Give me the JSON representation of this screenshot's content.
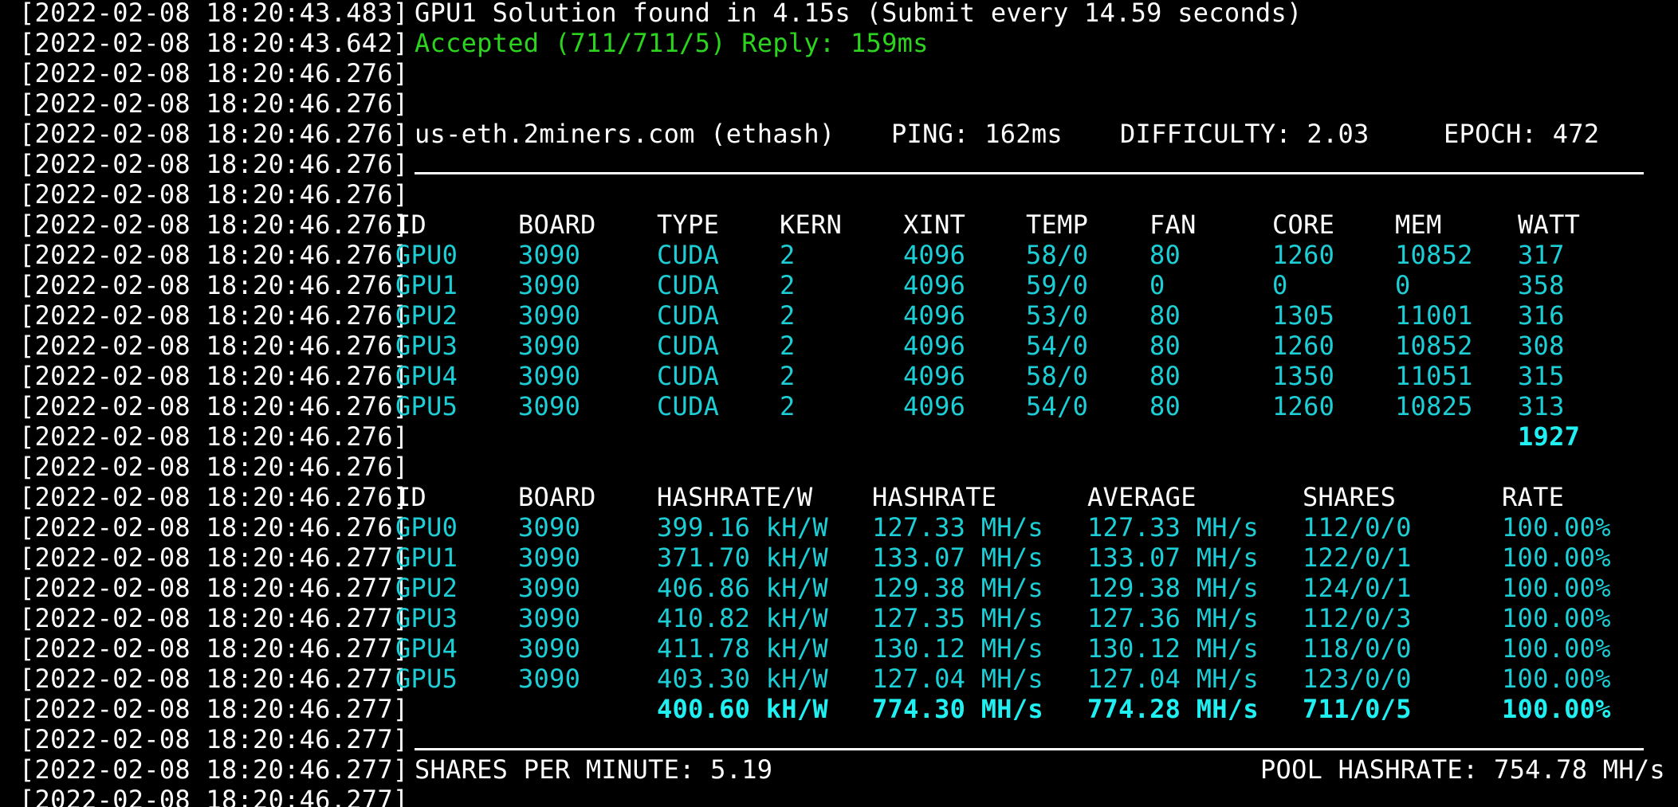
{
  "top": {
    "ts1": "[2022-02-08 18:20:43.483]",
    "msg1": "GPU1 Solution found in 4.15s (Submit every 14.59 seconds)",
    "ts2": "[2022-02-08 18:20:43.642]",
    "msg2": "Accepted (711/711/5) Reply: 159ms"
  },
  "pool": {
    "ts": "[2022-02-08 18:20:46.276]",
    "host": "us-eth.2miners.com (ethash)",
    "ping": "PING: 162ms",
    "difficulty": "DIFFICULTY: 2.03",
    "epoch": "EPOCH: 472"
  },
  "ts_a": "[2022-02-08 18:20:46.276]",
  "ts_b": "[2022-02-08 18:20:46.277]",
  "device_table": {
    "headers": [
      "ID",
      "BOARD",
      "TYPE",
      "KERN",
      "XINT",
      "TEMP",
      "FAN",
      "CORE",
      "MEM",
      "WATT"
    ],
    "rows": [
      [
        "GPU0",
        "3090",
        "CUDA",
        "2",
        "4096",
        "58/0",
        "80",
        "1260",
        "10852",
        "317"
      ],
      [
        "GPU1",
        "3090",
        "CUDA",
        "2",
        "4096",
        "59/0",
        "0",
        "0",
        "0",
        "358"
      ],
      [
        "GPU2",
        "3090",
        "CUDA",
        "2",
        "4096",
        "53/0",
        "80",
        "1305",
        "11001",
        "316"
      ],
      [
        "GPU3",
        "3090",
        "CUDA",
        "2",
        "4096",
        "54/0",
        "80",
        "1260",
        "10852",
        "308"
      ],
      [
        "GPU4",
        "3090",
        "CUDA",
        "2",
        "4096",
        "58/0",
        "80",
        "1350",
        "11051",
        "315"
      ],
      [
        "GPU5",
        "3090",
        "CUDA",
        "2",
        "4096",
        "54/0",
        "80",
        "1260",
        "10825",
        "313"
      ]
    ],
    "total_watt": "1927"
  },
  "hash_table": {
    "headers": [
      "ID",
      "BOARD",
      "HASHRATE/W",
      "HASHRATE",
      "AVERAGE",
      "SHARES",
      "RATE"
    ],
    "rows": [
      [
        "GPU0",
        "3090",
        "399.16 kH/W",
        "127.33 MH/s",
        "127.33 MH/s",
        "112/0/0",
        "100.00%"
      ],
      [
        "GPU1",
        "3090",
        "371.70 kH/W",
        "133.07 MH/s",
        "133.07 MH/s",
        "122/0/1",
        "100.00%"
      ],
      [
        "GPU2",
        "3090",
        "406.86 kH/W",
        "129.38 MH/s",
        "129.38 MH/s",
        "124/0/1",
        "100.00%"
      ],
      [
        "GPU3",
        "3090",
        "410.82 kH/W",
        "127.35 MH/s",
        "127.36 MH/s",
        "112/0/3",
        "100.00%"
      ],
      [
        "GPU4",
        "3090",
        "411.78 kH/W",
        "130.12 MH/s",
        "130.12 MH/s",
        "118/0/0",
        "100.00%"
      ],
      [
        "GPU5",
        "3090",
        "403.30 kH/W",
        "127.04 MH/s",
        "127.04 MH/s",
        "123/0/0",
        "100.00%"
      ]
    ],
    "totals": [
      "400.60 kH/W",
      "774.30 MH/s",
      "774.28 MH/s",
      "711/0/5",
      "100.00%"
    ]
  },
  "footer": {
    "spm": "SHARES PER MINUTE: 5.19",
    "pool_hashrate": "POOL HASHRATE: 754.78 MH/s"
  },
  "colors": {
    "background": "#000000",
    "text": "#ffffff",
    "value_cyan": "#1ccfd6",
    "total_cyan": "#21f0f2",
    "accepted_green": "#2cd51d"
  }
}
